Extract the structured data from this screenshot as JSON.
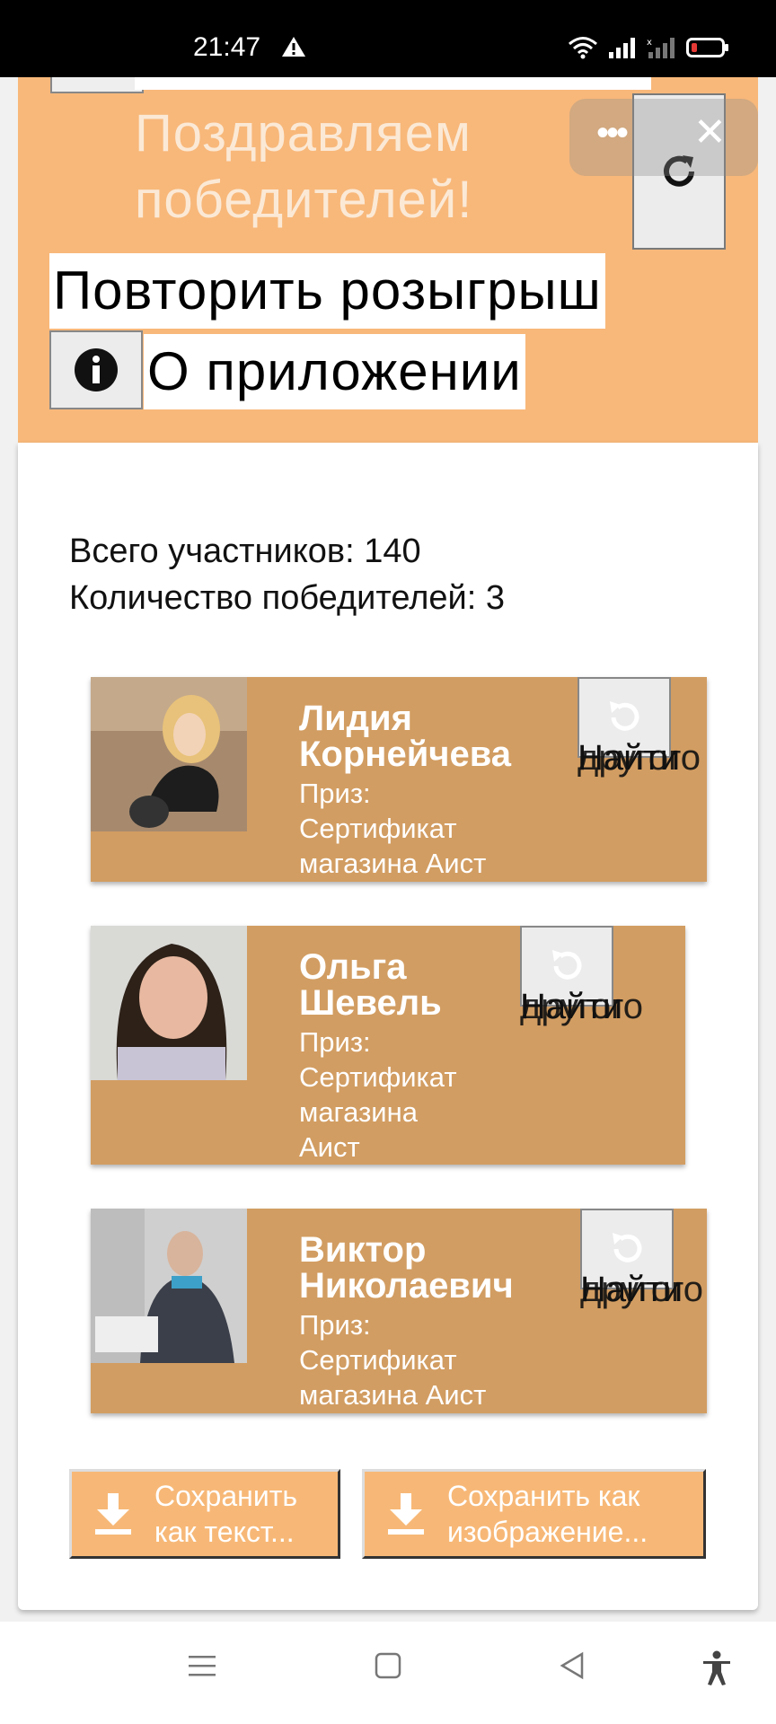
{
  "status_bar": {
    "time": "21:47"
  },
  "header": {
    "congrats_line1": "Поздравляем",
    "congrats_line2": "победителей!",
    "repeat_label": "Повторить розыгрыш",
    "about_label": "О приложении"
  },
  "stats": {
    "total": "Всего участников: 140",
    "winners_count": "Количество победителей: 3"
  },
  "winners": [
    {
      "name_line1": "Лидия",
      "name_line2": "Корнейчева",
      "prize": [
        "Приз:",
        "Сертификат",
        "магазина Аист"
      ],
      "button_label_a": "Найти",
      "button_label_b": "другого"
    },
    {
      "name_line1": "Ольга",
      "name_line2": "Шевель",
      "prize": [
        "Приз:",
        "Сертификат",
        "магазина",
        "Аист"
      ],
      "button_label_a": "Найти",
      "button_label_b": "другого"
    },
    {
      "name_line1": "Виктор",
      "name_line2": "Николаевич",
      "prize": [
        "Приз:",
        "Сертификат",
        "магазина Аист"
      ],
      "button_label_a": "Найти",
      "button_label_b": "другого"
    }
  ],
  "save_buttons": {
    "text_line1": "Сохранить",
    "text_line2": "как текст...",
    "image_line1": "Сохранить как",
    "image_line2": "изображение..."
  },
  "colors": {
    "header_orange": "#f8b87a",
    "winner_tan": "#d29d62",
    "save_orange": "#f7b877"
  }
}
